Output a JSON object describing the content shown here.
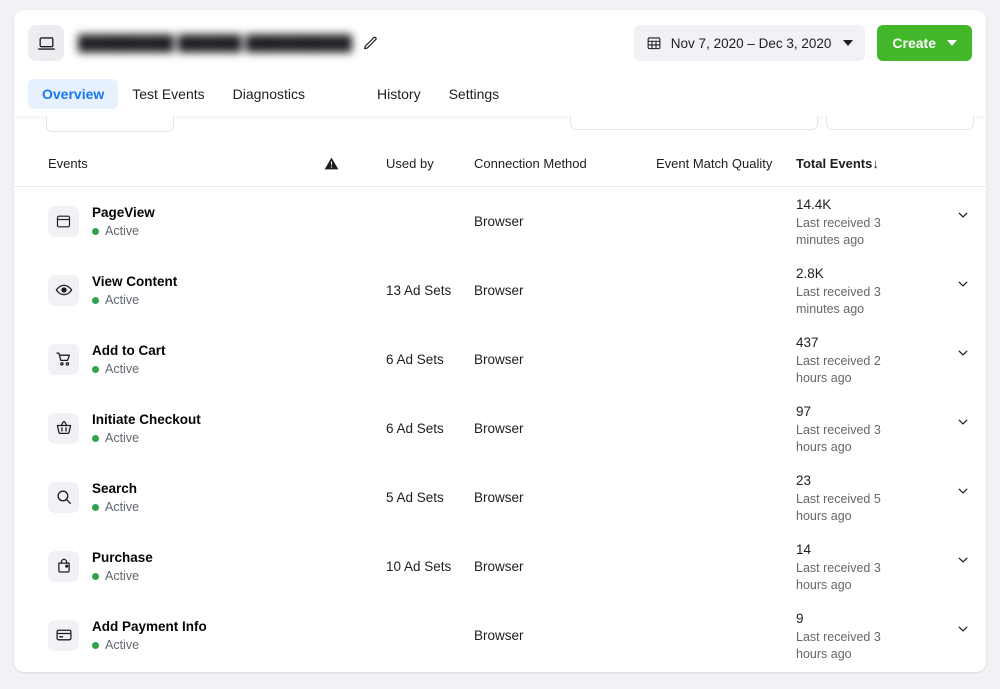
{
  "header": {
    "dataset_icon": "laptop-icon",
    "dataset_title": "█████████ ██████ ██████████",
    "edit_icon": "pencil-icon",
    "date_range": "Nov 7, 2020 – Dec 3, 2020",
    "calendar_icon": "calendar-icon",
    "create_label": "Create"
  },
  "tabs": [
    {
      "label": "Overview",
      "active": true
    },
    {
      "label": "Test Events",
      "active": false
    },
    {
      "label": "Diagnostics",
      "active": false
    },
    {
      "label": "History",
      "active": false
    },
    {
      "label": "Settings",
      "active": false
    }
  ],
  "table": {
    "columns": {
      "events": "Events",
      "warning_icon": "warning-triangle-icon",
      "used_by": "Used by",
      "connection_method": "Connection Method",
      "event_match_quality": "Event Match Quality",
      "total_events": "Total Events",
      "sort_arrow": "↓"
    },
    "rows": [
      {
        "icon": "browser-window-icon",
        "name": "PageView",
        "status": "Active",
        "status_color": "#31a24c",
        "used_by": "",
        "connection_method": "Browser",
        "event_match_quality": "",
        "total_events": "14.4K",
        "last_received": "Last received 3 minutes ago"
      },
      {
        "icon": "eye-icon",
        "name": "View Content",
        "status": "Active",
        "status_color": "#31a24c",
        "used_by": "13 Ad Sets",
        "connection_method": "Browser",
        "event_match_quality": "",
        "total_events": "2.8K",
        "last_received": "Last received 3 minutes ago"
      },
      {
        "icon": "shopping-cart-icon",
        "name": "Add to Cart",
        "status": "Active",
        "status_color": "#31a24c",
        "used_by": "6 Ad Sets",
        "connection_method": "Browser",
        "event_match_quality": "",
        "total_events": "437",
        "last_received": "Last received 2 hours ago"
      },
      {
        "icon": "shopping-basket-icon",
        "name": "Initiate Checkout",
        "status": "Active",
        "status_color": "#31a24c",
        "used_by": "6 Ad Sets",
        "connection_method": "Browser",
        "event_match_quality": "",
        "total_events": "97",
        "last_received": "Last received 3 hours ago"
      },
      {
        "icon": "search-icon",
        "name": "Search",
        "status": "Active",
        "status_color": "#31a24c",
        "used_by": "5 Ad Sets",
        "connection_method": "Browser",
        "event_match_quality": "",
        "total_events": "23",
        "last_received": "Last received 5 hours ago"
      },
      {
        "icon": "shopping-bag-icon",
        "name": "Purchase",
        "status": "Active",
        "status_color": "#31a24c",
        "used_by": "10 Ad Sets",
        "connection_method": "Browser",
        "event_match_quality": "",
        "total_events": "14",
        "last_received": "Last received 3 hours ago"
      },
      {
        "icon": "credit-card-icon",
        "name": "Add Payment Info",
        "status": "Active",
        "status_color": "#31a24c",
        "used_by": "",
        "connection_method": "Browser",
        "event_match_quality": "",
        "total_events": "9",
        "last_received": "Last received 3 hours ago"
      }
    ],
    "row_expand_icon": "chevron-down-icon"
  },
  "colors": {
    "accent_blue": "#1877f2",
    "create_green": "#42b72a",
    "status_green": "#31a24c",
    "page_bg": "#f0f2f5"
  }
}
